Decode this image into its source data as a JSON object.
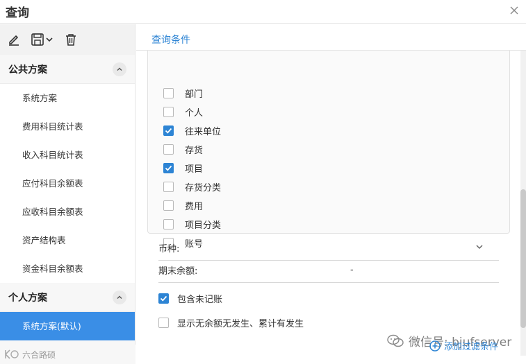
{
  "window": {
    "title": "查询",
    "close_icon": "close-icon"
  },
  "toolbar": {
    "edit_icon": "edit-icon",
    "save_icon": "save-dropdown-icon",
    "delete_icon": "trash-icon"
  },
  "sidebar": {
    "groups": [
      {
        "label": "公共方案",
        "items": [
          "系统方案",
          "费用科目统计表",
          "收入科目统计表",
          "应付科目余额表",
          "应收科目余额表",
          "资产结构表",
          "资金科目余额表"
        ]
      },
      {
        "label": "个人方案",
        "items": [
          "系统方案(默认)"
        ],
        "active_item": "系统方案(默认)"
      }
    ],
    "bottom_watermark": "六合路硕"
  },
  "main": {
    "section_title": "查询条件",
    "checkboxes": [
      {
        "label": "部门",
        "checked": false
      },
      {
        "label": "个人",
        "checked": false
      },
      {
        "label": "往来单位",
        "checked": true
      },
      {
        "label": "存货",
        "checked": false
      },
      {
        "label": "项目",
        "checked": true
      },
      {
        "label": "存货分类",
        "checked": false
      },
      {
        "label": "费用",
        "checked": false
      },
      {
        "label": "项目分类",
        "checked": false
      },
      {
        "label": "账号",
        "checked": false
      }
    ],
    "currency_label": "币种:",
    "ending_balance_label": "期末余额:",
    "ending_balance_value": "-",
    "include_unposted": {
      "label": "包含未记账",
      "checked": true
    },
    "show_no_balance": {
      "label": "显示无余额无发生、累计有发生",
      "checked": false
    },
    "add_filter_label": "添加过滤条件"
  },
  "watermark": {
    "text": "微信号: bjufserver"
  },
  "colors": {
    "accent": "#2d84d4",
    "active_item_bg": "#3a8ee6"
  }
}
